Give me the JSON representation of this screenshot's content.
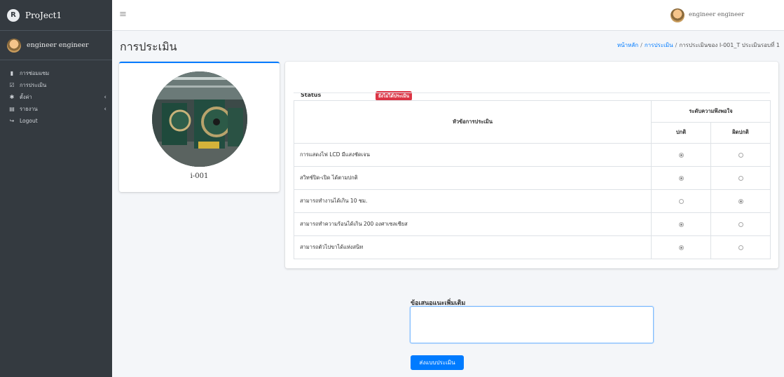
{
  "brand": {
    "name": "ProJect1",
    "logo_letter": "R"
  },
  "user": {
    "name": "engineer engineer"
  },
  "sidebar": {
    "items": [
      {
        "label": "การซ่อมแซม",
        "icon": "clipboard-icon",
        "glyph": "▮",
        "has_caret": false
      },
      {
        "label": "การประเมิน",
        "icon": "checklist-icon",
        "glyph": "☑",
        "has_caret": false
      },
      {
        "label": "ตั้งค่า",
        "icon": "gear-icon",
        "glyph": "✱",
        "has_caret": true
      },
      {
        "label": "รายงาน",
        "icon": "report-icon",
        "glyph": "▤",
        "has_caret": true
      },
      {
        "label": "Logout",
        "icon": "logout-icon",
        "glyph": "↪",
        "has_caret": false
      }
    ]
  },
  "header": {
    "menu_icon": "hamburger-icon"
  },
  "page": {
    "title": "การประเมิน",
    "breadcrumb": {
      "home": "หน้าหลัก",
      "section": "การประเมิน",
      "current": "การประเมินของ I-001_T ประเมินรอบที่ 1"
    }
  },
  "machine": {
    "name": "i-001"
  },
  "evaluation": {
    "status_label": "Status",
    "status_value": "ยังไม่ได้ประเมิน",
    "status_color": "#dc3545",
    "table": {
      "topic_header": "หัวข้อการประเมิน",
      "group_header": "ระดับความพึงพอใจ",
      "normal_header": "ปกติ",
      "abnormal_header": "ผิดปกติ",
      "rows": [
        {
          "topic": "การแสดงไฟ LCD มีแสงชัดเจน",
          "selected": "normal"
        },
        {
          "topic": "สวิทช์ปิด-เปิด ได้ตามปกติ",
          "selected": "normal"
        },
        {
          "topic": "สามารถทำงานได้เกิน 10 ชม.",
          "selected": "abnormal"
        },
        {
          "topic": "สามารถทำความร้อนได้เกิน 200 องศาเซลเซียส",
          "selected": "normal"
        },
        {
          "topic": "สามารถตัวไปขาได้แห่งสนิท",
          "selected": "normal"
        }
      ]
    }
  },
  "suggestion": {
    "label": "ข้อเสนอแนะเพิ่มเติม",
    "value": "",
    "submit_label": "ส่งแบบประเมิน"
  },
  "colors": {
    "primary": "#007bff",
    "sidebar_bg": "#343a40",
    "danger": "#dc3545"
  }
}
